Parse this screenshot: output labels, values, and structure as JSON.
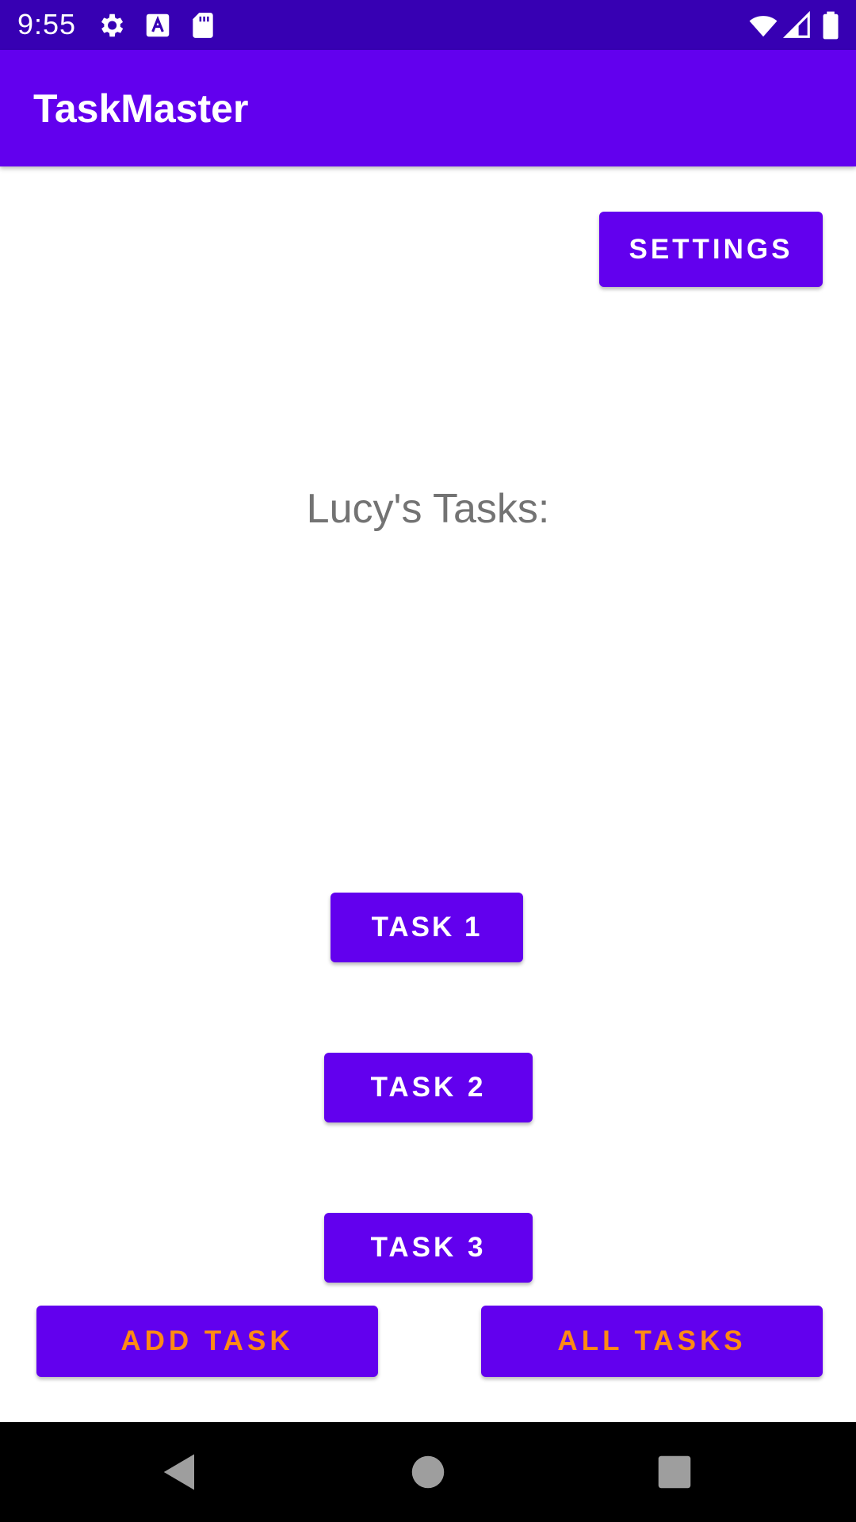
{
  "status_bar": {
    "time": "9:55",
    "icons": [
      "settings-gear-icon",
      "keyboard-a-icon",
      "sd-card-icon",
      "wifi-icon",
      "cell-signal-icon",
      "battery-icon"
    ]
  },
  "app_bar": {
    "title": "TaskMaster",
    "color": "#6200ee"
  },
  "main": {
    "settings_label": "SETTINGS",
    "heading": "Lucy's Tasks:",
    "tasks": [
      "TASK 1",
      "TASK 2",
      "TASK 3"
    ],
    "add_task_label": "ADD TASK",
    "all_tasks_label": "ALL TASKS"
  },
  "colors": {
    "primary": "#6200ee",
    "status_bar": "#3700b3",
    "accent_text": "#ff8a14",
    "heading_text": "#737373"
  },
  "nav_bar": {
    "icons": [
      "back-triangle-icon",
      "home-circle-icon",
      "recents-square-icon"
    ]
  }
}
